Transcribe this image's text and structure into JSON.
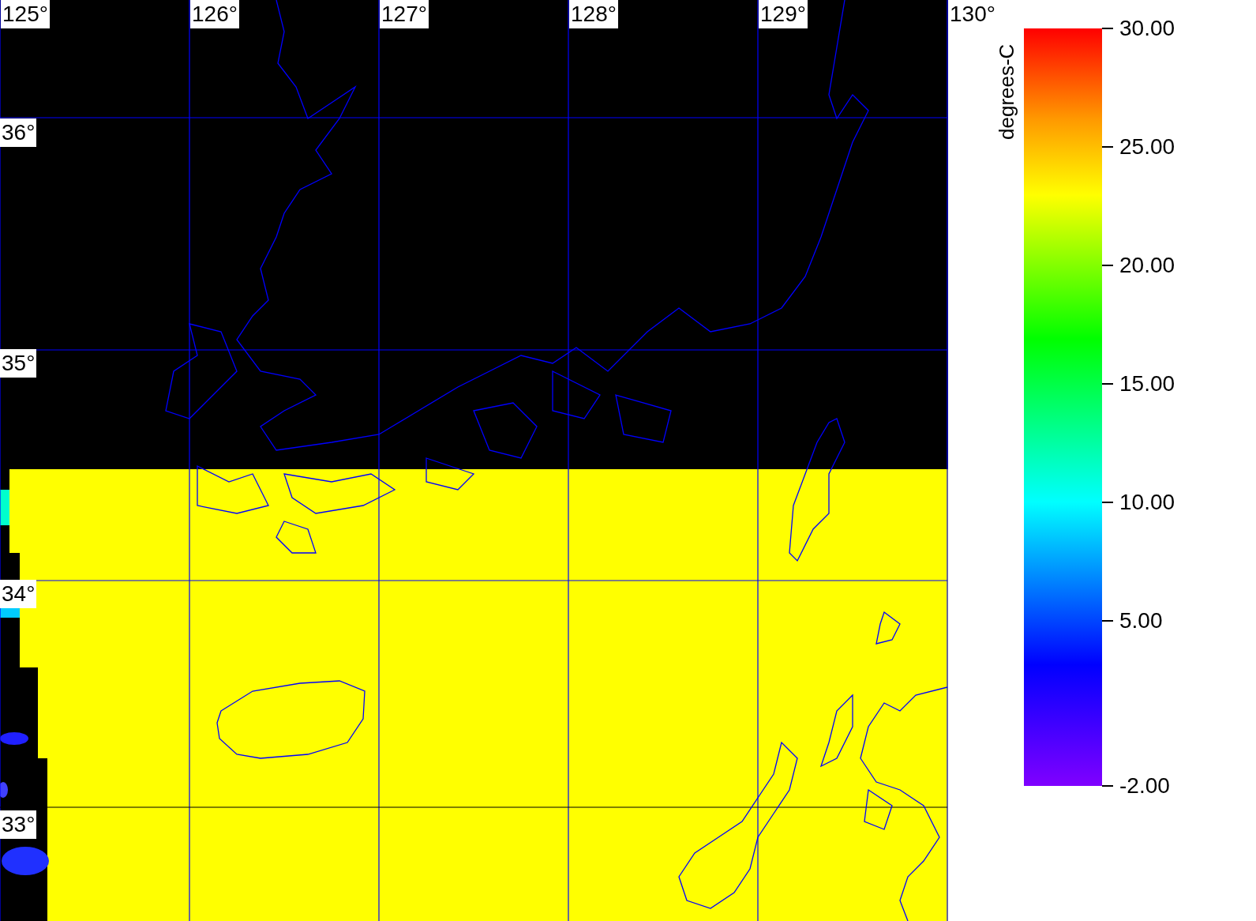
{
  "map": {
    "longitude_labels": [
      "125°",
      "126°",
      "127°",
      "128°",
      "129°",
      "130°"
    ],
    "latitude_labels": [
      "36°",
      "35°",
      "34°",
      "33°"
    ]
  },
  "colorbar": {
    "unit_label": "degrees-C",
    "tick_labels": [
      "30.00",
      "25.00",
      "20.00",
      "15.00",
      "10.00",
      "5.00",
      "-2.00"
    ]
  }
}
